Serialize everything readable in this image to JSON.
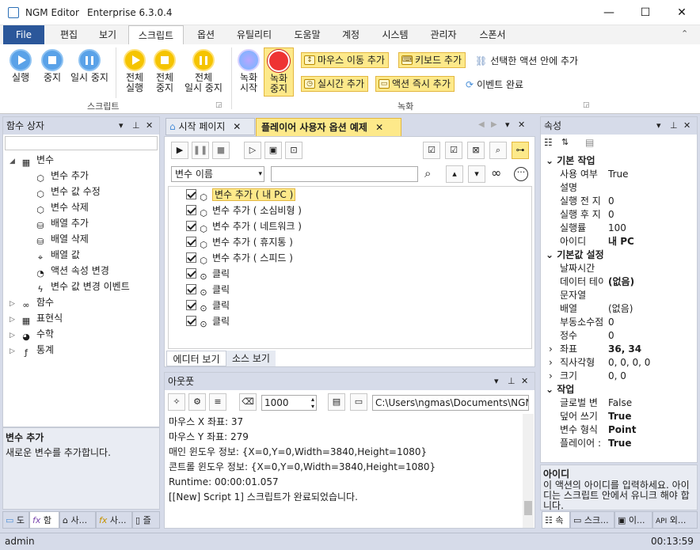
{
  "window": {
    "app_name": "NGM Editor",
    "edition": "Enterprise 6.3.0.4",
    "min": "—",
    "max": "☐",
    "close": "✕"
  },
  "menu": {
    "tabs": [
      "File",
      "편집",
      "보기",
      "스크립트",
      "옵션",
      "유틸리티",
      "도움말",
      "계정",
      "시스템",
      "관리자",
      "스폰서"
    ],
    "active": "스크립트"
  },
  "ribbon": {
    "script_group": {
      "label": "스크립트",
      "run": "실행",
      "stop": "중지",
      "pause": "일시 중지",
      "run_all_1": "전체",
      "run_all_2": "실행",
      "stop_all_1": "전체",
      "stop_all_2": "중지",
      "pause_all_1": "전체",
      "pause_all_2": "일시 중지"
    },
    "record_group": {
      "label": "녹화",
      "rec_start_1": "녹화",
      "rec_start_2": "시작",
      "rec_stop_1": "녹화",
      "rec_stop_2": "중지",
      "mouse_move": "마우스 이동 추가",
      "keyboard": "키보드 추가",
      "add_in_action": "선택한 액션 안에 추가",
      "realtime": "실시간 추가",
      "instant": "액션 즉시 추가",
      "event_done": "이벤트 완료"
    }
  },
  "function_panel": {
    "title": "함수 상자",
    "items": [
      {
        "label": "변수",
        "level": 0,
        "expanded": true,
        "icon": "variables-icon"
      },
      {
        "label": "변수 추가",
        "level": 1,
        "icon": "cube-icon"
      },
      {
        "label": "변수 값 수정",
        "level": 1,
        "icon": "cube-icon"
      },
      {
        "label": "변수 삭제",
        "level": 1,
        "icon": "cube-icon"
      },
      {
        "label": "배열 추가",
        "level": 1,
        "icon": "database-icon"
      },
      {
        "label": "배열 삭제",
        "level": 1,
        "icon": "database-icon"
      },
      {
        "label": "배열 값",
        "level": 1,
        "icon": "pointer-icon"
      },
      {
        "label": "액션 속성 변경",
        "level": 1,
        "icon": "clock-icon"
      },
      {
        "label": "변수 값 변경 이벤트",
        "level": 1,
        "icon": "bolt-icon"
      },
      {
        "label": "함수",
        "level": 0,
        "expanded": false,
        "icon": "infinity-icon"
      },
      {
        "label": "표현식",
        "level": 0,
        "expanded": false,
        "icon": "grid-icon"
      },
      {
        "label": "수학",
        "level": 0,
        "expanded": false,
        "icon": "pie-icon"
      },
      {
        "label": "통계",
        "level": 0,
        "expanded": false,
        "icon": "fx-icon"
      }
    ],
    "desc_title": "변수 추가",
    "desc_text": "새로운 변수를 추가합니다.",
    "bottom_tabs": [
      "도",
      "함",
      "사...",
      "사...",
      "즐"
    ]
  },
  "editor": {
    "tabs": [
      "시작 페이지",
      "플레이어 사용자 옵션 예제"
    ],
    "filter_select": "변수 이름",
    "filter_value": "",
    "actions": [
      {
        "label": "변수 추가 ( 내 PC )",
        "icon": "cube-icon",
        "selected": true
      },
      {
        "label": "변수 추가 ( 소심비형 )",
        "icon": "cube-icon"
      },
      {
        "label": "변수 추가 ( 네트워크 )",
        "icon": "cube-icon"
      },
      {
        "label": "변수 추가 ( 휴지통 )",
        "icon": "cube-icon"
      },
      {
        "label": "변수 추가 ( 스피드 )",
        "icon": "cube-icon"
      },
      {
        "label": "클릭",
        "icon": "mouse-icon"
      },
      {
        "label": "클릭",
        "icon": "mouse-icon"
      },
      {
        "label": "클릭",
        "icon": "mouse-icon"
      },
      {
        "label": "클릭",
        "icon": "mouse-icon"
      }
    ],
    "view_tabs": [
      "에디터 보기",
      "소스 보기"
    ]
  },
  "output": {
    "title": "아웃풋",
    "count": "1000",
    "path": "C:\\Users\\ngmas\\Documents\\NGM6\\",
    "lines": [
      "마우스 X 좌표: 37",
      "마우스 Y 좌표: 279",
      "매인 윈도우 정보: {X=0,Y=0,Width=3840,Height=1080}",
      "콘트롤 윈도우 정보: {X=0,Y=0,Width=3840,Height=1080}",
      "Runtime: 00:00:01.057",
      "[[New] Script 1] 스크립트가 완료되었습니다."
    ]
  },
  "properties": {
    "title": "속성",
    "rows": [
      {
        "cat": "기본 작업"
      },
      {
        "k": "사용 여부",
        "v": "True"
      },
      {
        "k": "설명",
        "v": ""
      },
      {
        "k": "실행 전 지",
        "v": "0"
      },
      {
        "k": "실행 후 지",
        "v": "0"
      },
      {
        "k": "실행률",
        "v": "100"
      },
      {
        "k": "아이디",
        "v": "내 PC",
        "b": true
      },
      {
        "cat": "기본값 설정"
      },
      {
        "k": "날짜시간",
        "v": ""
      },
      {
        "k": "데이터 테이",
        "v": "(없음)",
        "b": true
      },
      {
        "k": "문자열",
        "v": ""
      },
      {
        "k": "배열",
        "v": "(없음)"
      },
      {
        "k": "부동소수점",
        "v": "0"
      },
      {
        "k": "정수",
        "v": "0"
      },
      {
        "k": "좌표",
        "v": "36, 34",
        "b": true,
        "exp": true
      },
      {
        "k": "직사각형",
        "v": "0, 0, 0, 0",
        "exp": true
      },
      {
        "k": "크기",
        "v": "0, 0",
        "exp": true
      },
      {
        "cat": "작업"
      },
      {
        "k": "글로벌 변",
        "v": "False"
      },
      {
        "k": "덮어 쓰기",
        "v": "True",
        "b": true
      },
      {
        "k": "변수 형식",
        "v": "Point",
        "b": true
      },
      {
        "k": "플레이어 :",
        "v": "True",
        "b": true
      }
    ],
    "desc_title": "아이디",
    "desc_text": "이 액션의 아이디를 입력하세요. 아이디는 스크립트 안에서 유니크 해야 합니다.",
    "bottom_tabs": [
      "속",
      "스크...",
      "이...",
      "외..."
    ]
  },
  "status": {
    "user": "admin",
    "time": "00:13:59"
  }
}
